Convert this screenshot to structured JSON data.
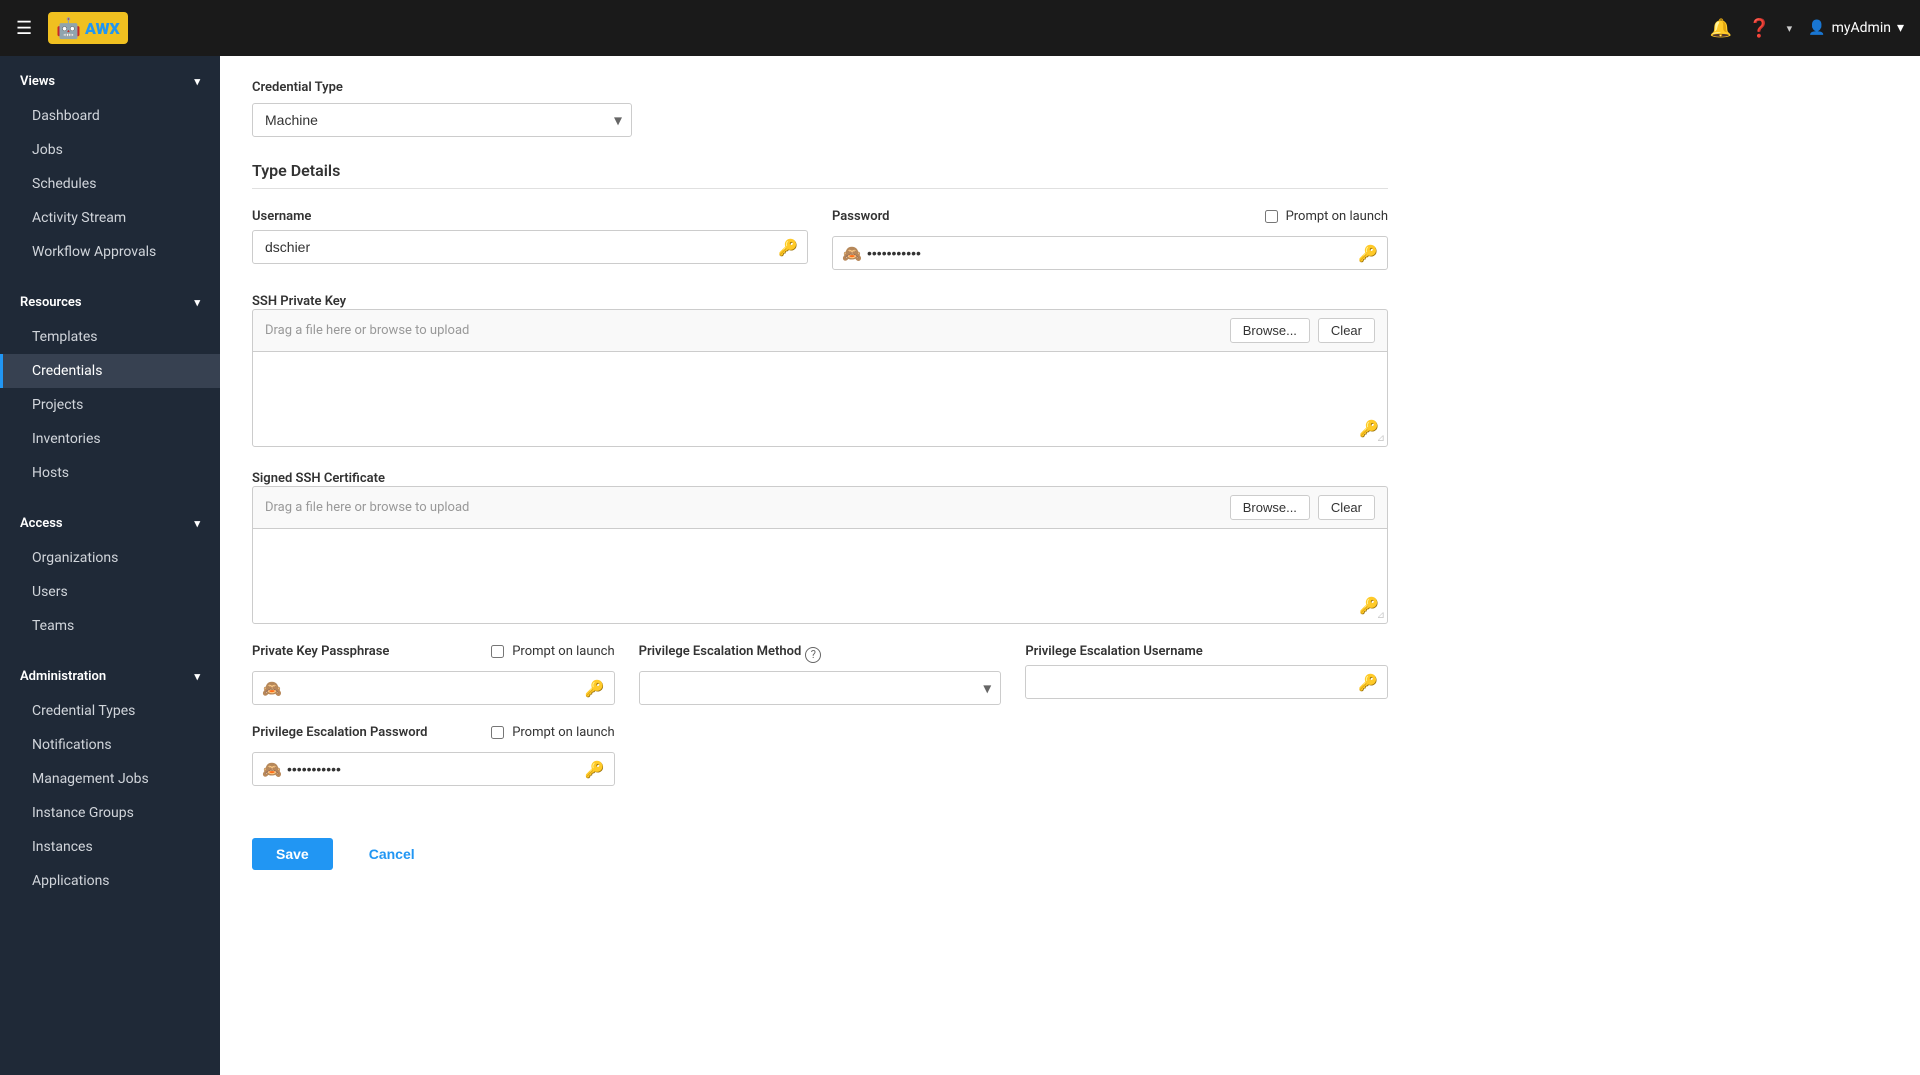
{
  "topNav": {
    "logoText": "AWX",
    "userName": "myAdmin",
    "bellIcon": "🔔",
    "helpIcon": "?",
    "chevronIcon": "▾"
  },
  "sidebar": {
    "views": {
      "sectionLabel": "Views",
      "items": [
        {
          "label": "Dashboard",
          "id": "dashboard"
        },
        {
          "label": "Jobs",
          "id": "jobs"
        },
        {
          "label": "Schedules",
          "id": "schedules"
        },
        {
          "label": "Activity Stream",
          "id": "activity-stream"
        },
        {
          "label": "Workflow Approvals",
          "id": "workflow-approvals"
        }
      ]
    },
    "resources": {
      "sectionLabel": "Resources",
      "items": [
        {
          "label": "Templates",
          "id": "templates"
        },
        {
          "label": "Credentials",
          "id": "credentials",
          "active": true
        },
        {
          "label": "Projects",
          "id": "projects"
        },
        {
          "label": "Inventories",
          "id": "inventories"
        },
        {
          "label": "Hosts",
          "id": "hosts"
        }
      ]
    },
    "access": {
      "sectionLabel": "Access",
      "items": [
        {
          "label": "Organizations",
          "id": "organizations"
        },
        {
          "label": "Users",
          "id": "users"
        },
        {
          "label": "Teams",
          "id": "teams"
        }
      ]
    },
    "administration": {
      "sectionLabel": "Administration",
      "items": [
        {
          "label": "Credential Types",
          "id": "credential-types"
        },
        {
          "label": "Notifications",
          "id": "notifications"
        },
        {
          "label": "Management Jobs",
          "id": "management-jobs"
        },
        {
          "label": "Instance Groups",
          "id": "instance-groups"
        },
        {
          "label": "Instances",
          "id": "instances"
        },
        {
          "label": "Applications",
          "id": "applications"
        }
      ]
    }
  },
  "form": {
    "credentialTypeLabel": "Credential Type",
    "credentialTypeValue": "Machine",
    "sectionTitle": "Type Details",
    "usernameLabel": "Username",
    "usernameValue": "dschier",
    "passwordLabel": "Password",
    "passwordValue": "••••••••",
    "promptOnLaunchLabel": "Prompt on launch",
    "sshPrivateKeyLabel": "SSH Private Key",
    "sshPrivateKeyPlaceholder": "Drag a file here or browse to upload",
    "browseLabel": "Browse...",
    "clearLabel": "Clear",
    "signedSSHCertLabel": "Signed SSH Certificate",
    "signedSSHCertPlaceholder": "Drag a file here or browse to upload",
    "privateKeyPassphraseLabel": "Private Key Passphrase",
    "privateKeyPassphrasePromptLabel": "Prompt on launch",
    "privilegeEscalationMethodLabel": "Privilege Escalation Method",
    "privilegeEscalationUsernameLabel": "Privilege Escalation Username",
    "privilegeEscalationPasswordLabel": "Privilege Escalation Password",
    "privilegeEscalationPasswordPromptLabel": "Prompt on launch",
    "privilegeEscalationPasswordValue": "••••••••",
    "saveLabel": "Save",
    "cancelLabel": "Cancel"
  }
}
